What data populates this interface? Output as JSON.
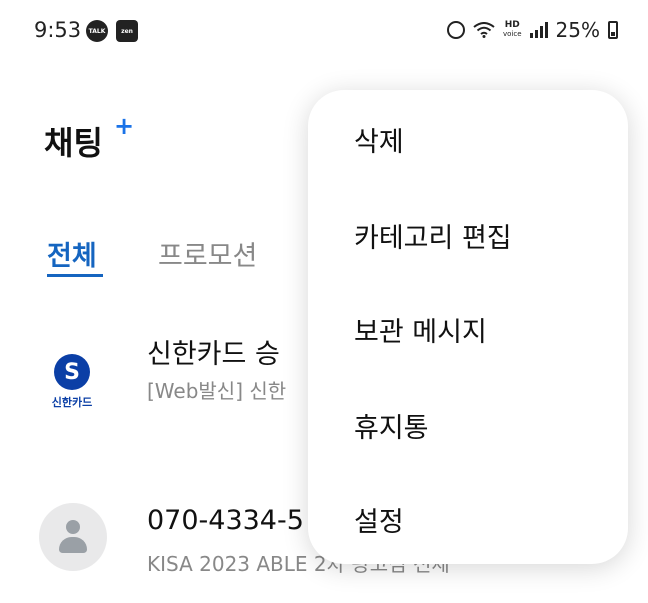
{
  "status_bar": {
    "time": "9:53",
    "app_icons": [
      "TALK",
      "zen"
    ],
    "hd_label": "HD",
    "hd_sub": "voice",
    "battery": "25%"
  },
  "header": {
    "title": "채팅",
    "plus": "+"
  },
  "tabs": [
    {
      "label": "전체",
      "active": true
    },
    {
      "label": "프로모션",
      "active": false
    }
  ],
  "chats": [
    {
      "name": "신한카드 승",
      "preview1": "[Web발신] 신한",
      "preview2": "",
      "logo_letter": "S",
      "logo_name": "신한카드"
    },
    {
      "name": "070-4334-5",
      "preview1": "KISA 2023 ABLE 2차 광고심 전체"
    }
  ],
  "menu": {
    "items": [
      "삭제",
      "카테고리 편집",
      "보관 메시지",
      "휴지통",
      "설정"
    ]
  },
  "colors": {
    "accent": "#1565c0",
    "plus": "#1a73e8",
    "shinhan": "#0b3fa6"
  }
}
